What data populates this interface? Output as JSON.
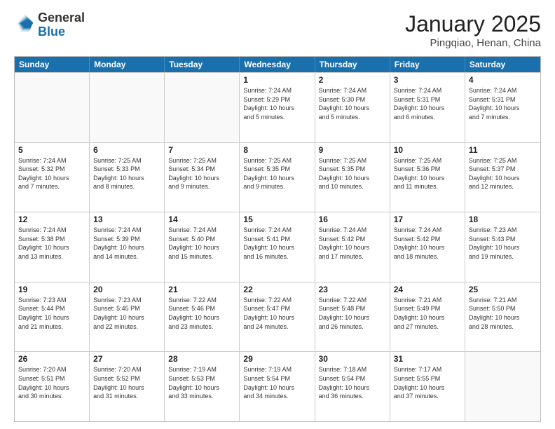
{
  "logo": {
    "general": "General",
    "blue": "Blue"
  },
  "title": "January 2025",
  "subtitle": "Pingqiao, Henan, China",
  "headers": [
    "Sunday",
    "Monday",
    "Tuesday",
    "Wednesday",
    "Thursday",
    "Friday",
    "Saturday"
  ],
  "weeks": [
    [
      {
        "num": "",
        "info": "",
        "empty": true
      },
      {
        "num": "",
        "info": "",
        "empty": true
      },
      {
        "num": "",
        "info": "",
        "empty": true
      },
      {
        "num": "1",
        "info": "Sunrise: 7:24 AM\nSunset: 5:29 PM\nDaylight: 10 hours\nand 5 minutes.",
        "empty": false
      },
      {
        "num": "2",
        "info": "Sunrise: 7:24 AM\nSunset: 5:30 PM\nDaylight: 10 hours\nand 5 minutes.",
        "empty": false
      },
      {
        "num": "3",
        "info": "Sunrise: 7:24 AM\nSunset: 5:31 PM\nDaylight: 10 hours\nand 6 minutes.",
        "empty": false
      },
      {
        "num": "4",
        "info": "Sunrise: 7:24 AM\nSunset: 5:31 PM\nDaylight: 10 hours\nand 7 minutes.",
        "empty": false
      }
    ],
    [
      {
        "num": "5",
        "info": "Sunrise: 7:24 AM\nSunset: 5:32 PM\nDaylight: 10 hours\nand 7 minutes.",
        "empty": false
      },
      {
        "num": "6",
        "info": "Sunrise: 7:25 AM\nSunset: 5:33 PM\nDaylight: 10 hours\nand 8 minutes.",
        "empty": false
      },
      {
        "num": "7",
        "info": "Sunrise: 7:25 AM\nSunset: 5:34 PM\nDaylight: 10 hours\nand 9 minutes.",
        "empty": false
      },
      {
        "num": "8",
        "info": "Sunrise: 7:25 AM\nSunset: 5:35 PM\nDaylight: 10 hours\nand 9 minutes.",
        "empty": false
      },
      {
        "num": "9",
        "info": "Sunrise: 7:25 AM\nSunset: 5:35 PM\nDaylight: 10 hours\nand 10 minutes.",
        "empty": false
      },
      {
        "num": "10",
        "info": "Sunrise: 7:25 AM\nSunset: 5:36 PM\nDaylight: 10 hours\nand 11 minutes.",
        "empty": false
      },
      {
        "num": "11",
        "info": "Sunrise: 7:25 AM\nSunset: 5:37 PM\nDaylight: 10 hours\nand 12 minutes.",
        "empty": false
      }
    ],
    [
      {
        "num": "12",
        "info": "Sunrise: 7:24 AM\nSunset: 5:38 PM\nDaylight: 10 hours\nand 13 minutes.",
        "empty": false
      },
      {
        "num": "13",
        "info": "Sunrise: 7:24 AM\nSunset: 5:39 PM\nDaylight: 10 hours\nand 14 minutes.",
        "empty": false
      },
      {
        "num": "14",
        "info": "Sunrise: 7:24 AM\nSunset: 5:40 PM\nDaylight: 10 hours\nand 15 minutes.",
        "empty": false
      },
      {
        "num": "15",
        "info": "Sunrise: 7:24 AM\nSunset: 5:41 PM\nDaylight: 10 hours\nand 16 minutes.",
        "empty": false
      },
      {
        "num": "16",
        "info": "Sunrise: 7:24 AM\nSunset: 5:42 PM\nDaylight: 10 hours\nand 17 minutes.",
        "empty": false
      },
      {
        "num": "17",
        "info": "Sunrise: 7:24 AM\nSunset: 5:42 PM\nDaylight: 10 hours\nand 18 minutes.",
        "empty": false
      },
      {
        "num": "18",
        "info": "Sunrise: 7:23 AM\nSunset: 5:43 PM\nDaylight: 10 hours\nand 19 minutes.",
        "empty": false
      }
    ],
    [
      {
        "num": "19",
        "info": "Sunrise: 7:23 AM\nSunset: 5:44 PM\nDaylight: 10 hours\nand 21 minutes.",
        "empty": false
      },
      {
        "num": "20",
        "info": "Sunrise: 7:23 AM\nSunset: 5:45 PM\nDaylight: 10 hours\nand 22 minutes.",
        "empty": false
      },
      {
        "num": "21",
        "info": "Sunrise: 7:22 AM\nSunset: 5:46 PM\nDaylight: 10 hours\nand 23 minutes.",
        "empty": false
      },
      {
        "num": "22",
        "info": "Sunrise: 7:22 AM\nSunset: 5:47 PM\nDaylight: 10 hours\nand 24 minutes.",
        "empty": false
      },
      {
        "num": "23",
        "info": "Sunrise: 7:22 AM\nSunset: 5:48 PM\nDaylight: 10 hours\nand 26 minutes.",
        "empty": false
      },
      {
        "num": "24",
        "info": "Sunrise: 7:21 AM\nSunset: 5:49 PM\nDaylight: 10 hours\nand 27 minutes.",
        "empty": false
      },
      {
        "num": "25",
        "info": "Sunrise: 7:21 AM\nSunset: 5:50 PM\nDaylight: 10 hours\nand 28 minutes.",
        "empty": false
      }
    ],
    [
      {
        "num": "26",
        "info": "Sunrise: 7:20 AM\nSunset: 5:51 PM\nDaylight: 10 hours\nand 30 minutes.",
        "empty": false
      },
      {
        "num": "27",
        "info": "Sunrise: 7:20 AM\nSunset: 5:52 PM\nDaylight: 10 hours\nand 31 minutes.",
        "empty": false
      },
      {
        "num": "28",
        "info": "Sunrise: 7:19 AM\nSunset: 5:53 PM\nDaylight: 10 hours\nand 33 minutes.",
        "empty": false
      },
      {
        "num": "29",
        "info": "Sunrise: 7:19 AM\nSunset: 5:54 PM\nDaylight: 10 hours\nand 34 minutes.",
        "empty": false
      },
      {
        "num": "30",
        "info": "Sunrise: 7:18 AM\nSunset: 5:54 PM\nDaylight: 10 hours\nand 36 minutes.",
        "empty": false
      },
      {
        "num": "31",
        "info": "Sunrise: 7:17 AM\nSunset: 5:55 PM\nDaylight: 10 hours\nand 37 minutes.",
        "empty": false
      },
      {
        "num": "",
        "info": "",
        "empty": true
      }
    ]
  ]
}
